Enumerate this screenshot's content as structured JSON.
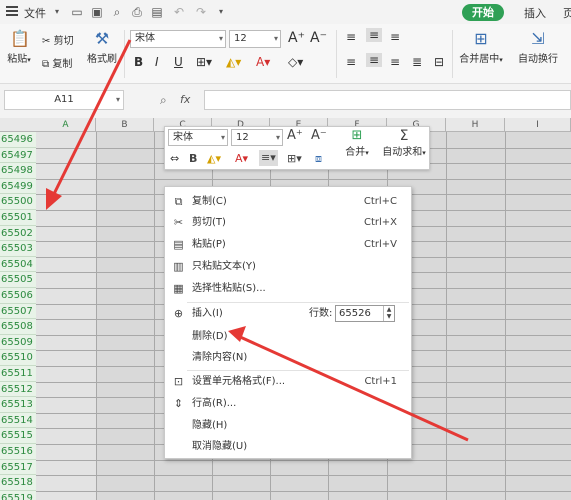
{
  "titlebar": {
    "file_label": "文件",
    "start_button": "开始",
    "tab_insert": "插入",
    "tab_partial": "页"
  },
  "ribbon": {
    "paste": "粘贴",
    "cut": "剪切",
    "copy": "复制",
    "format_painter": "格式刷",
    "font_name": "宋体",
    "font_size": "12",
    "merge_center": "合并居中",
    "auto_wrap": "自动换行"
  },
  "formula_bar": {
    "cell_ref": "A11",
    "fx": "fx",
    "formula_value": ""
  },
  "grid": {
    "columns": [
      "A",
      "B",
      "C",
      "D",
      "E",
      "F",
      "G",
      "H",
      "I"
    ],
    "rows": [
      "65496",
      "65497",
      "65498",
      "65499",
      "65500",
      "65501",
      "65502",
      "65503",
      "65504",
      "65505",
      "65506",
      "65507",
      "65508",
      "65509",
      "65510",
      "65511",
      "65512",
      "65513",
      "65514",
      "65515",
      "65516",
      "65517",
      "65518",
      "65519"
    ]
  },
  "mini_toolbar": {
    "font_name": "宋体",
    "font_size": "12",
    "merge": "合并",
    "autosum": "自动求和"
  },
  "context_menu": {
    "copy": {
      "label": "复制(C)",
      "shortcut": "Ctrl+C"
    },
    "cut": {
      "label": "剪切(T)",
      "shortcut": "Ctrl+X"
    },
    "paste": {
      "label": "粘贴(P)",
      "shortcut": "Ctrl+V"
    },
    "paste_text": {
      "label": "只粘贴文本(Y)"
    },
    "paste_special": {
      "label": "选择性粘贴(S)..."
    },
    "insert": {
      "label": "插入(I)",
      "rows_label": "行数:",
      "rows_value": "65526"
    },
    "delete": {
      "label": "删除(D)"
    },
    "clear": {
      "label": "清除内容(N)"
    },
    "format_cells": {
      "label": "设置单元格格式(F)...",
      "shortcut": "Ctrl+1"
    },
    "row_height": {
      "label": "行高(R)..."
    },
    "hide": {
      "label": "隐藏(H)"
    },
    "unhide": {
      "label": "取消隐藏(U)"
    }
  },
  "colors": {
    "accent_green": "#2fa055",
    "arrow_red": "#e53935",
    "row_header_green": "#2b8a3e"
  }
}
